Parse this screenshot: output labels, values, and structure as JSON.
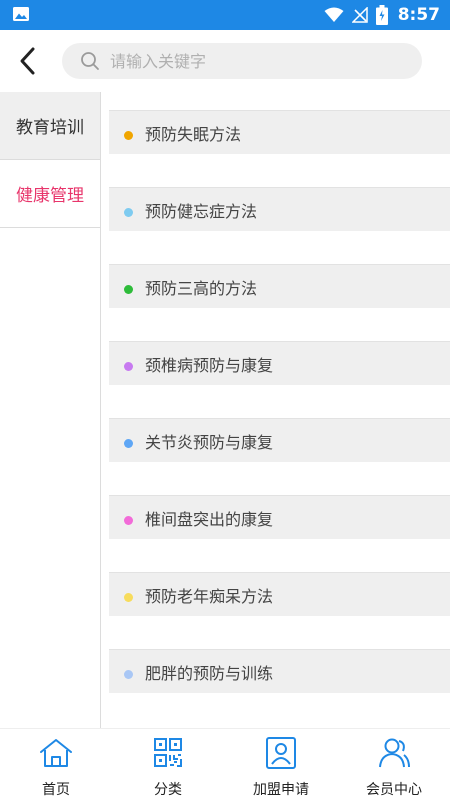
{
  "status_bar": {
    "time": "8:57"
  },
  "header": {
    "search_placeholder": "请输入关键字"
  },
  "sidebar": {
    "categories": [
      {
        "label": "教育培训",
        "selected": false
      },
      {
        "label": "健康管理",
        "selected": true
      }
    ]
  },
  "content": {
    "items": [
      {
        "label": "预防失眠方法",
        "dot_color": "#f0a500"
      },
      {
        "label": "预防健忘症方法",
        "dot_color": "#7ecbf0"
      },
      {
        "label": "预防三高的方法",
        "dot_color": "#2ebc3a"
      },
      {
        "label": "颈椎病预防与康复",
        "dot_color": "#c77af0"
      },
      {
        "label": "关节炎预防与康复",
        "dot_color": "#5ea6f5"
      },
      {
        "label": "椎间盘突出的康复",
        "dot_color": "#f26bd8"
      },
      {
        "label": "预防老年痴呆方法",
        "dot_color": "#f7dc5c"
      },
      {
        "label": "肥胖的预防与训练",
        "dot_color": "#a9c7f5"
      }
    ]
  },
  "tabbar": {
    "tabs": [
      {
        "label": "首页",
        "icon": "home-icon"
      },
      {
        "label": "分类",
        "icon": "qr-grid-icon"
      },
      {
        "label": "加盟申请",
        "icon": "user-card-icon"
      },
      {
        "label": "会员中心",
        "icon": "users-icon"
      }
    ]
  },
  "colors": {
    "accent": "#1e88e5",
    "active_category": "#e8356b",
    "icon_blue": "#1e88e5"
  }
}
